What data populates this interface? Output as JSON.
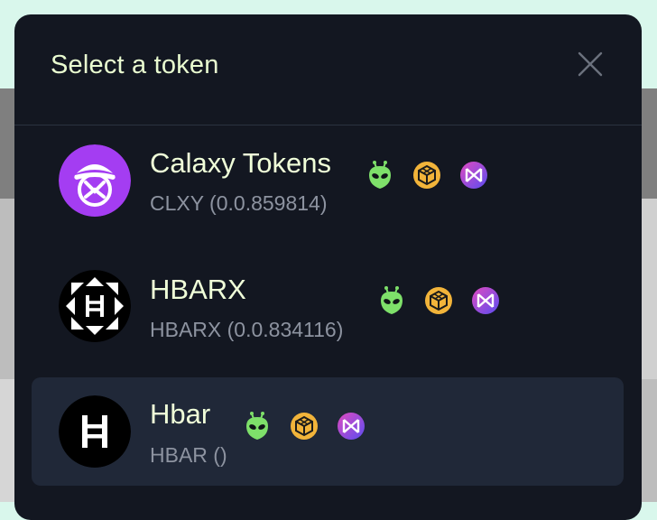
{
  "modal": {
    "title": "Select a token"
  },
  "tokens": [
    {
      "name": "Calaxy Tokens",
      "subtitle": "CLXY (0.0.859814)",
      "avatar_color": "#a43df2",
      "badges": [
        "alien-icon",
        "hashpack-icon",
        "hashport-icon"
      ]
    },
    {
      "name": "HBARX",
      "subtitle": "HBARX (0.0.834116)",
      "avatar_color": "#000000",
      "badges": [
        "alien-icon",
        "hashpack-icon",
        "hashport-icon"
      ]
    },
    {
      "name": "Hbar",
      "subtitle": "HBAR ()",
      "avatar_color": "#000000",
      "selected": true,
      "badges": [
        "alien-icon",
        "hashpack-icon",
        "hashport-icon"
      ]
    }
  ],
  "colors": {
    "modal_bg": "#131721",
    "selected_row": "#202838",
    "title": "#e9fbd0",
    "subtitle": "#8d93a0",
    "alien": "#7ee06a",
    "gold": "#f2b43a",
    "purple": "#8a4df0"
  }
}
